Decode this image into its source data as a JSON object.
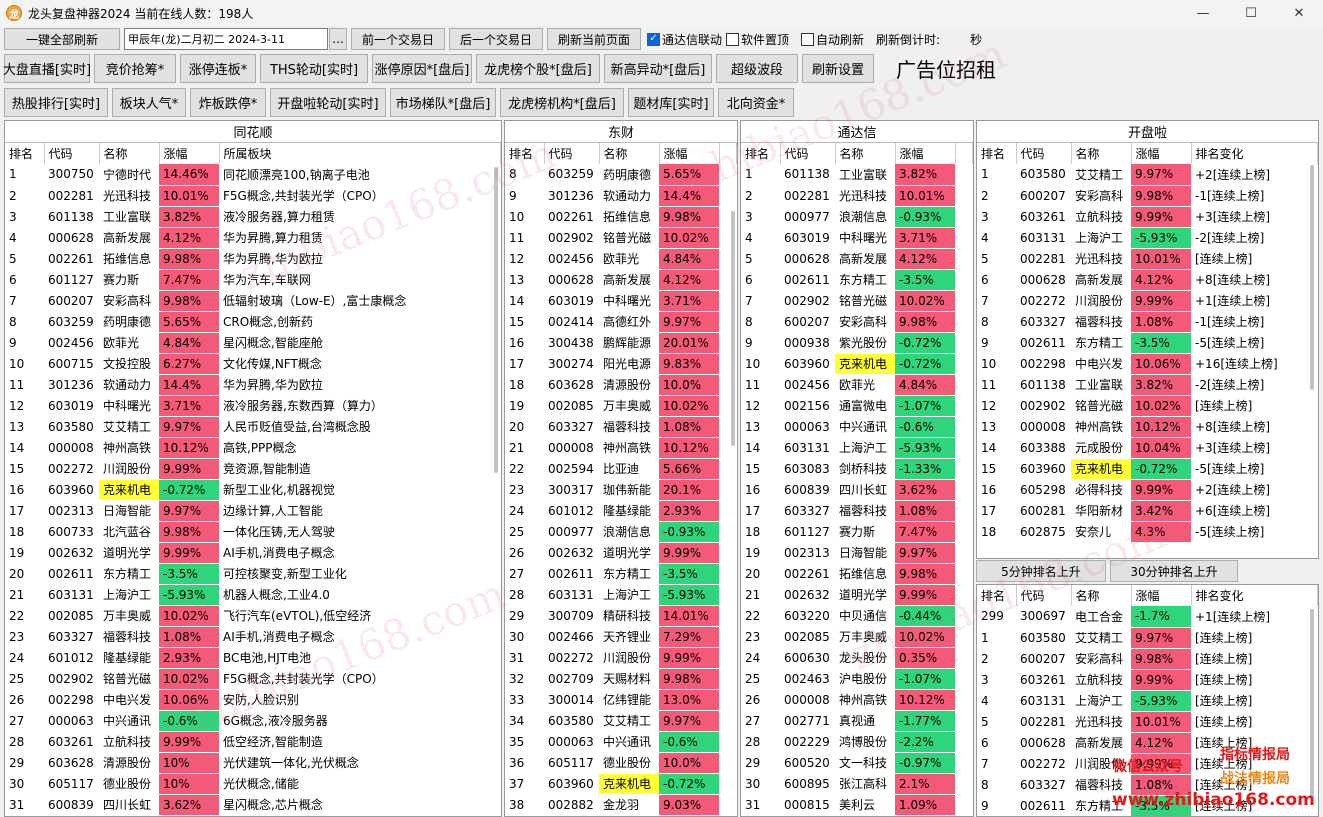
{
  "window": {
    "title": "龙头复盘神器2024 当前在线人数：198人",
    "app_icon": "龙"
  },
  "toolbar": {
    "refresh_all": "一键全部刷新",
    "date_value": "甲辰年(龙)二月初二  2024-3-11",
    "ellipsis": "...",
    "prev_day": "前一个交易日",
    "next_day": "后一个交易日",
    "refresh_page": "刷新当前页面",
    "tdx_link": "通达信联动",
    "pin_top": "软件置顶",
    "auto_refresh": "自动刷新",
    "countdown_label": "刷新倒计时:",
    "countdown_unit": "秒"
  },
  "buttons_row1": [
    "大盘直播[实时]",
    "竞价抢筹*",
    "涨停连板*",
    "THS轮动[实时]",
    "涨停原因*[盘后]",
    "龙虎榜个股*[盘后]",
    "新高异动*[盘后]",
    "超级波段",
    "刷新设置"
  ],
  "ad_text": "广告位招租",
  "buttons_row2": [
    "热股排行[实时]",
    "板块人气*",
    "炸板跌停*",
    "开盘啦轮动[实时]",
    "市场梯队*[盘后]",
    "龙虎榜机构*[盘后]",
    "题材库[实时]",
    "北向资金*"
  ],
  "colors": {
    "up": "#f25a78",
    "down": "#2ed57a",
    "highlight": "#ffff33"
  },
  "watermark": "zhibiao168.com",
  "footer_watermark": {
    "wechat": "微信公众号",
    "name1": "指标情报局",
    "name2": "战法情报局",
    "url": "www.zhibiao168.com"
  },
  "panels": {
    "ths": {
      "title": "同花顺",
      "headers": [
        "排名",
        "代码",
        "名称",
        "涨幅",
        "所属板块"
      ],
      "rows": [
        [
          "1",
          "300750",
          "宁德时代",
          "14.46%",
          "同花顺漂亮100,钠离子电池"
        ],
        [
          "2",
          "002281",
          "光迅科技",
          "10.01%",
          "F5G概念,共封装光学（CPO）"
        ],
        [
          "3",
          "601138",
          "工业富联",
          "3.82%",
          "液冷服务器,算力租赁"
        ],
        [
          "4",
          "000628",
          "高新发展",
          "4.12%",
          "华为昇腾,算力租赁"
        ],
        [
          "5",
          "002261",
          "拓维信息",
          "9.98%",
          "华为昇腾,华为欧拉"
        ],
        [
          "6",
          "601127",
          "赛力斯",
          "7.47%",
          "华为汽车,车联网"
        ],
        [
          "7",
          "600207",
          "安彩高科",
          "9.98%",
          "低辐射玻璃（Low-E）,富士康概念"
        ],
        [
          "8",
          "603259",
          "药明康德",
          "5.65%",
          "CRO概念,创新药"
        ],
        [
          "9",
          "002456",
          "欧菲光",
          "4.84%",
          "星闪概念,智能座舱"
        ],
        [
          "10",
          "600715",
          "文投控股",
          "6.27%",
          "文化传媒,NFT概念"
        ],
        [
          "11",
          "301236",
          "软通动力",
          "14.4%",
          "华为昇腾,华为欧拉"
        ],
        [
          "12",
          "603019",
          "中科曙光",
          "3.71%",
          "液冷服务器,东数西算（算力）"
        ],
        [
          "13",
          "603580",
          "艾艾精工",
          "9.97%",
          "人民币贬值受益,台湾概念股"
        ],
        [
          "14",
          "000008",
          "神州高铁",
          "10.12%",
          "高铁,PPP概念"
        ],
        [
          "15",
          "002272",
          "川润股份",
          "9.99%",
          "竞资源,智能制造"
        ],
        [
          "16",
          "603960",
          "克来机电",
          "-0.72%",
          "新型工业化,机器视觉"
        ],
        [
          "17",
          "002313",
          "日海智能",
          "9.97%",
          "边缘计算,人工智能"
        ],
        [
          "18",
          "600733",
          "北汽蓝谷",
          "9.98%",
          "一体化压铸,无人驾驶"
        ],
        [
          "19",
          "002632",
          "道明光学",
          "9.99%",
          "AI手机,消费电子概念"
        ],
        [
          "20",
          "002611",
          "东方精工",
          "-3.5%",
          "可控核聚变,新型工业化"
        ],
        [
          "21",
          "603131",
          "上海沪工",
          "-5.93%",
          "机器人概念,工业4.0"
        ],
        [
          "22",
          "002085",
          "万丰奥威",
          "10.02%",
          "飞行汽车(eVTOL),低空经济"
        ],
        [
          "23",
          "603327",
          "福蓉科技",
          "1.08%",
          "AI手机,消费电子概念"
        ],
        [
          "24",
          "601012",
          "隆基绿能",
          "2.93%",
          "BC电池,HJT电池"
        ],
        [
          "25",
          "002902",
          "铭普光磁",
          "10.02%",
          "F5G概念,共封装光学（CPO）"
        ],
        [
          "26",
          "002298",
          "中电兴发",
          "10.06%",
          "安防,人脸识别"
        ],
        [
          "27",
          "000063",
          "中兴通讯",
          "-0.6%",
          "6G概念,液冷服务器"
        ],
        [
          "28",
          "603261",
          "立航科技",
          "9.99%",
          "低空经济,智能制造"
        ],
        [
          "29",
          "603628",
          "清源股份",
          "10%",
          "光伏建筑一体化,光伏概念"
        ],
        [
          "30",
          "605117",
          "德业股份",
          "10%",
          "光伏概念,储能"
        ],
        [
          "31",
          "600839",
          "四川长虹",
          "3.62%",
          "星闪概念,芯片概念"
        ]
      ]
    },
    "df": {
      "title": "东财",
      "headers": [
        "排名",
        "代码",
        "名称",
        "涨幅"
      ],
      "rows": [
        [
          "8",
          "603259",
          "药明康德",
          "5.65%"
        ],
        [
          "9",
          "301236",
          "软通动力",
          "14.4%"
        ],
        [
          "10",
          "002261",
          "拓维信息",
          "9.98%"
        ],
        [
          "11",
          "002902",
          "铭普光磁",
          "10.02%"
        ],
        [
          "12",
          "002456",
          "欧菲光",
          "4.84%"
        ],
        [
          "13",
          "000628",
          "高新发展",
          "4.12%"
        ],
        [
          "14",
          "603019",
          "中科曙光",
          "3.71%"
        ],
        [
          "15",
          "002414",
          "高德红外",
          "9.97%"
        ],
        [
          "16",
          "300438",
          "鹏辉能源",
          "20.01%"
        ],
        [
          "17",
          "300274",
          "阳光电源",
          "9.83%"
        ],
        [
          "18",
          "603628",
          "清源股份",
          "10.0%"
        ],
        [
          "19",
          "002085",
          "万丰奥威",
          "10.02%"
        ],
        [
          "20",
          "603327",
          "福蓉科技",
          "1.08%"
        ],
        [
          "21",
          "000008",
          "神州高铁",
          "10.12%"
        ],
        [
          "22",
          "002594",
          "比亚迪",
          "5.66%"
        ],
        [
          "23",
          "300317",
          "珈伟新能",
          "20.1%"
        ],
        [
          "24",
          "601012",
          "隆基绿能",
          "2.93%"
        ],
        [
          "25",
          "000977",
          "浪潮信息",
          "-0.93%"
        ],
        [
          "26",
          "002632",
          "道明光学",
          "9.99%"
        ],
        [
          "27",
          "002611",
          "东方精工",
          "-3.5%"
        ],
        [
          "28",
          "603131",
          "上海沪工",
          "-5.93%"
        ],
        [
          "29",
          "300709",
          "精研科技",
          "14.01%"
        ],
        [
          "30",
          "002466",
          "天齐锂业",
          "7.29%"
        ],
        [
          "31",
          "002272",
          "川润股份",
          "9.99%"
        ],
        [
          "32",
          "002709",
          "天赐材料",
          "9.98%"
        ],
        [
          "33",
          "300014",
          "亿纬锂能",
          "13.0%"
        ],
        [
          "34",
          "603580",
          "艾艾精工",
          "9.97%"
        ],
        [
          "35",
          "000063",
          "中兴通讯",
          "-0.6%"
        ],
        [
          "36",
          "605117",
          "德业股份",
          "10.0%"
        ],
        [
          "37",
          "603960",
          "克来机电",
          "-0.72%"
        ],
        [
          "38",
          "002882",
          "金龙羽",
          "9.03%"
        ]
      ]
    },
    "tdx": {
      "title": "通达信",
      "headers": [
        "排名",
        "代码",
        "名称",
        "涨幅"
      ],
      "rows": [
        [
          "1",
          "601138",
          "工业富联",
          "3.82%"
        ],
        [
          "2",
          "002281",
          "光迅科技",
          "10.01%"
        ],
        [
          "3",
          "000977",
          "浪潮信息",
          "-0.93%"
        ],
        [
          "4",
          "603019",
          "中科曙光",
          "3.71%"
        ],
        [
          "5",
          "000628",
          "高新发展",
          "4.12%"
        ],
        [
          "6",
          "002611",
          "东方精工",
          "-3.5%"
        ],
        [
          "7",
          "002902",
          "铭普光磁",
          "10.02%"
        ],
        [
          "8",
          "600207",
          "安彩高科",
          "9.98%"
        ],
        [
          "9",
          "000938",
          "紫光股份",
          "-0.72%"
        ],
        [
          "10",
          "603960",
          "克来机电",
          "-0.72%"
        ],
        [
          "11",
          "002456",
          "欧菲光",
          "4.84%"
        ],
        [
          "12",
          "002156",
          "通富微电",
          "-1.07%"
        ],
        [
          "13",
          "000063",
          "中兴通讯",
          "-0.6%"
        ],
        [
          "14",
          "603131",
          "上海沪工",
          "-5.93%"
        ],
        [
          "15",
          "603083",
          "剑桥科技",
          "-1.33%"
        ],
        [
          "16",
          "600839",
          "四川长虹",
          "3.62%"
        ],
        [
          "17",
          "603327",
          "福蓉科技",
          "1.08%"
        ],
        [
          "18",
          "601127",
          "赛力斯",
          "7.47%"
        ],
        [
          "19",
          "002313",
          "日海智能",
          "9.97%"
        ],
        [
          "20",
          "002261",
          "拓维信息",
          "9.98%"
        ],
        [
          "21",
          "002632",
          "道明光学",
          "9.99%"
        ],
        [
          "22",
          "603220",
          "中贝通信",
          "-0.44%"
        ],
        [
          "23",
          "002085",
          "万丰奥威",
          "10.02%"
        ],
        [
          "24",
          "600630",
          "龙头股份",
          "0.35%"
        ],
        [
          "25",
          "002463",
          "沪电股份",
          "-1.07%"
        ],
        [
          "26",
          "000008",
          "神州高铁",
          "10.12%"
        ],
        [
          "27",
          "002771",
          "真视通",
          "-1.77%"
        ],
        [
          "28",
          "002229",
          "鸿博股份",
          "-2.2%"
        ],
        [
          "29",
          "600520",
          "文一科技",
          "-0.97%"
        ],
        [
          "30",
          "600895",
          "张江高科",
          "2.1%"
        ],
        [
          "31",
          "000815",
          "美利云",
          "1.09%"
        ]
      ]
    },
    "kpl": {
      "title": "开盘啦",
      "headers": [
        "排名",
        "代码",
        "名称",
        "涨幅",
        "排名变化"
      ],
      "rows": [
        [
          "1",
          "603580",
          "艾艾精工",
          "9.97%",
          "+2[连续上榜]"
        ],
        [
          "2",
          "600207",
          "安彩高科",
          "9.98%",
          "-1[连续上榜]"
        ],
        [
          "3",
          "603261",
          "立航科技",
          "9.99%",
          "+3[连续上榜]"
        ],
        [
          "4",
          "603131",
          "上海沪工",
          "-5.93%",
          "-2[连续上榜]"
        ],
        [
          "5",
          "002281",
          "光迅科技",
          "10.01%",
          "[连续上榜]"
        ],
        [
          "6",
          "000628",
          "高新发展",
          "4.12%",
          "+8[连续上榜]"
        ],
        [
          "7",
          "002272",
          "川润股份",
          "9.99%",
          "+1[连续上榜]"
        ],
        [
          "8",
          "603327",
          "福蓉科技",
          "1.08%",
          "-1[连续上榜]"
        ],
        [
          "9",
          "002611",
          "东方精工",
          "-3.5%",
          "-5[连续上榜]"
        ],
        [
          "10",
          "002298",
          "中电兴发",
          "10.06%",
          "+16[连续上榜]"
        ],
        [
          "11",
          "601138",
          "工业富联",
          "3.82%",
          "-2[连续上榜]"
        ],
        [
          "12",
          "002902",
          "铭普光磁",
          "10.02%",
          "[连续上榜]"
        ],
        [
          "13",
          "000008",
          "神州高铁",
          "10.12%",
          "+8[连续上榜]"
        ],
        [
          "14",
          "603388",
          "元成股份",
          "10.04%",
          "+3[连续上榜]"
        ],
        [
          "15",
          "603960",
          "克来机电",
          "-0.72%",
          "-5[连续上榜]"
        ],
        [
          "16",
          "605298",
          "必得科技",
          "9.99%",
          "+2[连续上榜]"
        ],
        [
          "17",
          "600281",
          "华阳新材",
          "3.42%",
          "+6[连续上榜]"
        ],
        [
          "18",
          "602875",
          "安奈儿",
          "4.3%",
          "-5[连续上榜]"
        ]
      ]
    },
    "kpl_tabs": [
      "5分钟排名上升",
      "30分钟排名上升"
    ],
    "kpl2": {
      "headers": [
        "排名",
        "代码",
        "名称",
        "涨幅",
        "排名变化"
      ],
      "rows": [
        [
          "299",
          "300697",
          "电工合金",
          "-1.7%",
          "+1[连续上榜]"
        ],
        [
          "1",
          "603580",
          "艾艾精工",
          "9.97%",
          "[连续上榜]"
        ],
        [
          "2",
          "600207",
          "安彩高科",
          "9.98%",
          "[连续上榜]"
        ],
        [
          "3",
          "603261",
          "立航科技",
          "9.99%",
          "[连续上榜]"
        ],
        [
          "4",
          "603131",
          "上海沪工",
          "-5.93%",
          "[连续上榜]"
        ],
        [
          "5",
          "002281",
          "光迅科技",
          "10.01%",
          "[连续上榜]"
        ],
        [
          "6",
          "000628",
          "高新发展",
          "4.12%",
          "[连续上榜]"
        ],
        [
          "7",
          "002272",
          "川润股份",
          "9.99%",
          "[连续上榜]"
        ],
        [
          "8",
          "603327",
          "福蓉科技",
          "1.08%",
          "[连续上榜]"
        ],
        [
          "9",
          "002611",
          "东方精工",
          "-3.5%",
          "[连续上榜]"
        ]
      ]
    }
  }
}
